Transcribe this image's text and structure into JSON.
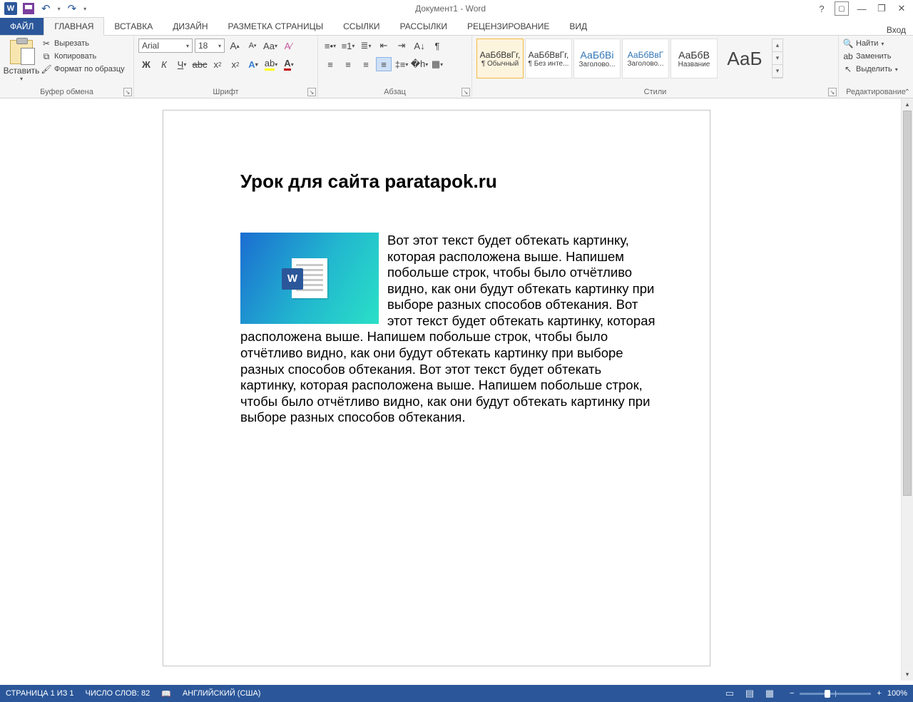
{
  "titlebar": {
    "doc_title": "Документ1 - Word",
    "login_label": "Вход"
  },
  "tabs": {
    "file": "ФАЙЛ",
    "home": "ГЛАВНАЯ",
    "insert": "ВСТАВКА",
    "design": "ДИЗАЙН",
    "layout": "РАЗМЕТКА СТРАНИЦЫ",
    "references": "ССЫЛКИ",
    "mailings": "РАССЫЛКИ",
    "review": "РЕЦЕНЗИРОВАНИЕ",
    "view": "ВИД"
  },
  "clipboard": {
    "paste": "Вставить",
    "cut": "Вырезать",
    "copy": "Копировать",
    "format_painter": "Формат по образцу",
    "group": "Буфер обмена"
  },
  "font": {
    "name": "Arial",
    "size": "18",
    "group": "Шрифт"
  },
  "paragraph": {
    "group": "Абзац"
  },
  "styles": {
    "group": "Стили",
    "items": [
      {
        "preview": "АаБбВвГг,",
        "label": "¶ Обычный"
      },
      {
        "preview": "АаБбВвГг,",
        "label": "¶ Без инте..."
      },
      {
        "preview": "АаБбВі",
        "label": "Заголово..."
      },
      {
        "preview": "АаБбВвГ",
        "label": "Заголово..."
      },
      {
        "preview": "АаБбВ",
        "label": "Название"
      }
    ],
    "big_preview": "АаБ"
  },
  "editing": {
    "find": "Найти",
    "replace": "Заменить",
    "select": "Выделить",
    "group": "Редактирование"
  },
  "document": {
    "heading": "Урок для сайта paratapok.ru",
    "body": "Вот этот текст будет обтекать картинку, которая расположена выше. Напишем побольше строк, чтобы было отчётливо видно, как они будут обтекать картинку при выборе разных способов обтекания. Вот этот текст будет обтекать картинку, которая расположена выше. Напишем побольше строк, чтобы было отчётливо видно, как они будут обтекать картинку при выборе разных способов обтекания. Вот этот текст будет обтекать картинку, которая расположена выше. Напишем побольше строк, чтобы было отчётливо видно, как они будут обтекать картинку при выборе разных способов обтекания."
  },
  "status": {
    "page": "СТРАНИЦА 1 ИЗ 1",
    "words": "ЧИСЛО СЛОВ: 82",
    "lang": "АНГЛИЙСКИЙ (США)",
    "zoom": "100%"
  }
}
